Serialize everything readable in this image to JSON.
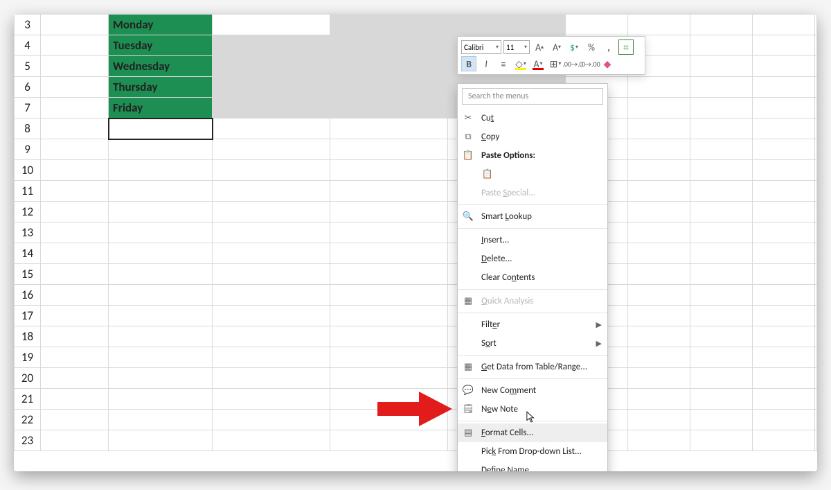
{
  "rows": [
    "3",
    "4",
    "5",
    "6",
    "7",
    "8",
    "9",
    "10",
    "11",
    "12",
    "13",
    "14",
    "15",
    "16",
    "17",
    "18",
    "19",
    "20",
    "21",
    "22",
    "23"
  ],
  "days": {
    "mon": "Monday",
    "tue": "Tuesday",
    "wed": "Wednesday",
    "thu": "Thursday",
    "fri": "Friday"
  },
  "minibar": {
    "font": "Calibri",
    "size": "11",
    "increase": "A^",
    "decrease": "Aˇ",
    "percent": "%",
    "comma": ","
  },
  "ctx": {
    "search_placeholder": "Search the menus",
    "cut": "Cut",
    "copy": "Copy",
    "paste_options": "Paste Options:",
    "paste_special": "Paste Special...",
    "smart_lookup": "Smart Lookup",
    "insert": "Insert...",
    "delete": "Delete...",
    "clear": "Clear Contents",
    "quick_analysis": "Quick Analysis",
    "filter": "Filter",
    "sort": "Sort",
    "get_data": "Get Data from Table/Range...",
    "new_comment": "New Comment",
    "new_note": "New Note",
    "format_cells": "Format Cells...",
    "pick_list": "Pick From Drop-down List...",
    "define_name": "Define Name..."
  }
}
